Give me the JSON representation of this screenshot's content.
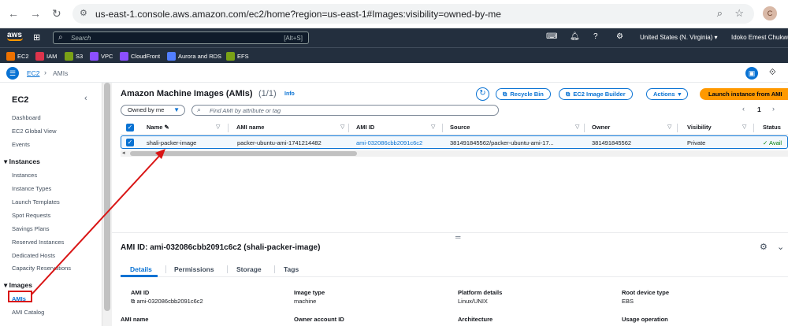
{
  "browser": {
    "url": "us-east-1.console.aws.amazon.com/ec2/home?region=us-east-1#Images:visibility=owned-by-me",
    "profile_initial": "C"
  },
  "aws_nav": {
    "logo_text": "aws",
    "search_placeholder": "Search",
    "search_shortcut": "[Alt+S]",
    "region": "United States (N. Virginia) ▾",
    "user": "Idoko Emest Chukwud"
  },
  "favorites": [
    {
      "label": "EC2",
      "color": "#ed7100"
    },
    {
      "label": "IAM",
      "color": "#dd344c"
    },
    {
      "label": "S3",
      "color": "#7aa116"
    },
    {
      "label": "VPC",
      "color": "#8c4fff"
    },
    {
      "label": "CloudFront",
      "color": "#8c4fff"
    },
    {
      "label": "Aurora and RDS",
      "color": "#527fff"
    },
    {
      "label": "EFS",
      "color": "#7aa116"
    }
  ],
  "breadcrumb": {
    "root": "EC2",
    "separator": "›",
    "current": "AMIs"
  },
  "sidebar": {
    "title": "EC2",
    "top_items": [
      "Dashboard",
      "EC2 Global View",
      "Events"
    ],
    "instances_label": "Instances",
    "instances_items": [
      "Instances",
      "Instance Types",
      "Launch Templates",
      "Spot Requests",
      "Savings Plans",
      "Reserved Instances",
      "Dedicated Hosts",
      "Capacity Reservations"
    ],
    "images_label": "Images",
    "images_items": [
      "AMIs",
      "AMI Catalog"
    ]
  },
  "list_panel": {
    "title": "Amazon Machine Images (AMIs)",
    "count": "(1/1)",
    "info": "Info",
    "recycle_bin": "Recycle Bin",
    "image_builder": "EC2 Image Builder",
    "actions": "Actions",
    "launch": "Launch instance from AMI",
    "owner_filter": "Owned by me",
    "filter_placeholder": "Find AMI by attribute or tag",
    "page": "1",
    "columns": [
      "Name",
      "AMI name",
      "AMI ID",
      "Source",
      "Owner",
      "Visibility",
      "Status"
    ],
    "rows": [
      {
        "name": "shali-packer-image",
        "ami_name": "packer-ubuntu-ami-1741214482",
        "ami_id": "ami-032086cbb2091c6c2",
        "source": "381491845562/packer-ubuntu-ami-17...",
        "owner": "381491845562",
        "visibility": "Private",
        "status": "Avail"
      }
    ]
  },
  "detail": {
    "title": "AMI ID: ami-032086cbb2091c6c2 (shali-packer-image)",
    "tabs": [
      "Details",
      "Permissions",
      "Storage",
      "Tags"
    ],
    "fields": [
      {
        "label": "AMI ID",
        "value": "ami-032086cbb2091c6c2"
      },
      {
        "label": "Image type",
        "value": "machine"
      },
      {
        "label": "Platform details",
        "value": "Linux/UNIX"
      },
      {
        "label": "Root device type",
        "value": "EBS"
      },
      {
        "label": "AMI name",
        "value": ""
      },
      {
        "label": "Owner account ID",
        "value": ""
      },
      {
        "label": "Architecture",
        "value": ""
      },
      {
        "label": "Usage operation",
        "value": ""
      }
    ]
  },
  "colors": {
    "accent": "#0972d3",
    "launch": "#ff9900",
    "nav_bg": "#232f3e",
    "annotation": "#d91515"
  }
}
